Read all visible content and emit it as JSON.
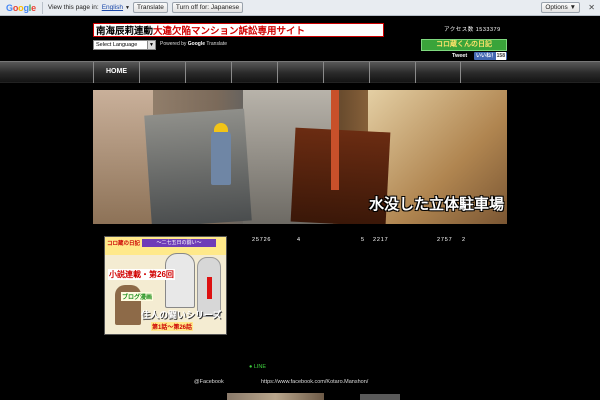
{
  "google_bar": {
    "logo": "Google",
    "view_text": "View this page in:",
    "language_link": "English",
    "language_arrow": "▼",
    "translate_button": "Translate",
    "turn_off_button": "Turn off for: Japanese",
    "options_button": "Options ▼",
    "close": "✕"
  },
  "header": {
    "banner_part1": "南海辰莉連動",
    "banner_part2": "大違欠陥マンション訴訟専用サイト",
    "counter": "アクセス数 1533379",
    "diary_badge": "コロ蔵くんの日記",
    "tweet_label": "Tweet",
    "like_label": "いいね！",
    "like_count": "158"
  },
  "translate_widget": {
    "select_label": "Select Language",
    "select_arrow": "▼",
    "powered_prefix": "Powered by",
    "powered_brand": "Google",
    "powered_suffix": "Translate"
  },
  "nav": {
    "items": [
      {
        "label": "HOME"
      },
      {
        "label": ""
      },
      {
        "label": ""
      },
      {
        "label": ""
      },
      {
        "label": ""
      },
      {
        "label": ""
      },
      {
        "label": ""
      },
      {
        "label": ""
      }
    ]
  },
  "hero": {
    "caption": "水没した立体駐車場"
  },
  "manga": {
    "title_small": "コロ蔵の日記",
    "ribbon": "～二七五日の闘い～",
    "headline": "小説連載・第26回",
    "sub": "ブログ漫画",
    "series": "住人の闘いシリーズ",
    "footer": "第1話～第26話"
  },
  "stats": {
    "s1": "25726",
    "s2": "4",
    "s3": "5",
    "s4": "2217",
    "s5": "2757",
    "s6": "2"
  },
  "footer": {
    "line": "● LINE",
    "facebook_label": "@Facebook",
    "facebook_url": "https://www.facebook.com/Kotaro.Manshon/"
  }
}
